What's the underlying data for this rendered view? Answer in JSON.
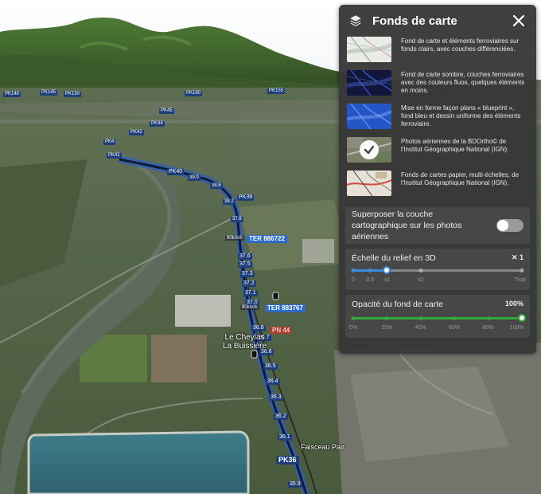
{
  "panel": {
    "title": "Fonds de carte",
    "basemaps": [
      {
        "label": "Fond de carte et éléments ferroviaires sur fonds clairs, avec couches différenciées.",
        "thumb": "light-map"
      },
      {
        "label": "Fond de carte sombre, couches ferroviaires avec des couleurs fluos, quelques éléments en moins.",
        "thumb": "dark-map"
      },
      {
        "label": "Mise en forme façon plans « blueprint », fond bleu et dessin uniforme des éléments ferroviaire.",
        "thumb": "blueprint-map"
      },
      {
        "label": "Photos aériennes de la BDOrtho© de l'Institut Géographique National (IGN).",
        "thumb": "aerial-photo",
        "selected": true
      },
      {
        "label": "Fonds de cartes papier, multi-échelles, de l'Institut Géographique National (IGN).",
        "thumb": "paper-map"
      }
    ],
    "overlay": {
      "label": "Superposer la couche cartographique sur les photos aériennes",
      "enabled": false
    },
    "relief": {
      "label": "Échelle du relief en 3D",
      "value_label": "✕ 1",
      "ticks": [
        "0",
        "0.5",
        "x1",
        "x2",
        "Trop"
      ],
      "value": 1
    },
    "opacity": {
      "label": "Opacité du fond de carte",
      "value_label": "100%",
      "ticks": [
        "0%",
        "20%",
        "40%",
        "60%",
        "80%",
        "100%"
      ],
      "value": 100
    }
  },
  "map": {
    "pk_labels": [
      "PK140",
      "PK145",
      "PK150",
      "PK160",
      "PK155",
      "PK4",
      "PK45",
      "PK44",
      "PK42",
      "PK41",
      "PK40",
      "PK39",
      "PK38",
      "PK37",
      "PK36"
    ],
    "track_km": [
      "39.0",
      "38.9",
      "38.8",
      "38.7",
      "38.6",
      "38.5",
      "38.4",
      "38.3",
      "38.2",
      "38.1",
      "38.0",
      "37.9",
      "37.8",
      "37.7",
      "37.6",
      "37.5",
      "37.4",
      "37.3",
      "37.2",
      "37.1",
      "37.0",
      "36.9",
      "36.8",
      "36.7",
      "36.6",
      "36.5",
      "36.4",
      "36.3",
      "36.2",
      "36.1",
      "35.9"
    ],
    "ter_labels": [
      "TER 886722",
      "TER 883767"
    ],
    "speed_labels": [
      "80km/h",
      "80km/h"
    ],
    "station": "Le Cheylas\nLa Buissière",
    "pn": "PN 44",
    "pk36": "PK36",
    "faisceau": "Faisceau Pair",
    "km_359": "35.9"
  },
  "colors": {
    "relief_accent": "#3a8be0",
    "opacity_accent": "#33a83a",
    "label_bg": "#1f3f7a"
  }
}
